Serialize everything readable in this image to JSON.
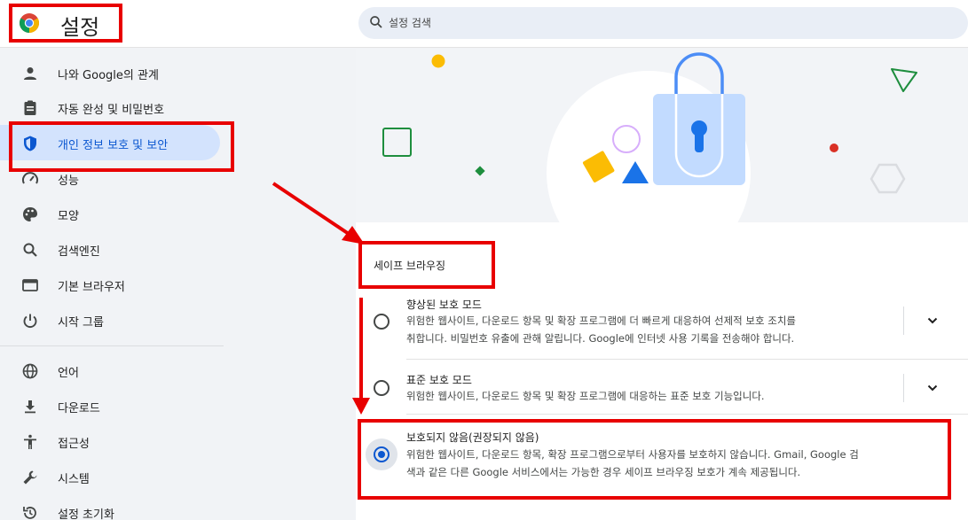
{
  "header": {
    "app_title": "설정",
    "search_placeholder": "설정 검색"
  },
  "sidebar": {
    "items": [
      {
        "label": "나와 Google의 관계",
        "icon": "person-icon"
      },
      {
        "label": "자동 완성 및 비밀번호",
        "icon": "clipboard-icon"
      },
      {
        "label": "개인 정보 보호 및 보안",
        "icon": "shield-icon",
        "active": true
      },
      {
        "label": "성능",
        "icon": "speedometer-icon"
      },
      {
        "label": "모양",
        "icon": "palette-icon"
      },
      {
        "label": "검색엔진",
        "icon": "search-icon"
      },
      {
        "label": "기본 브라우저",
        "icon": "browser-icon"
      },
      {
        "label": "시작 그룹",
        "icon": "power-icon"
      },
      {
        "label": "언어",
        "icon": "globe-icon"
      },
      {
        "label": "다운로드",
        "icon": "download-icon"
      },
      {
        "label": "접근성",
        "icon": "accessibility-icon"
      },
      {
        "label": "시스템",
        "icon": "wrench-icon"
      },
      {
        "label": "설정 초기화",
        "icon": "reset-icon"
      }
    ]
  },
  "main": {
    "section_title": "세이프 브라우징",
    "options": [
      {
        "title": "향상된 보호 모드",
        "desc_line1": "위험한 웹사이트, 다운로드 항목 및 확장 프로그램에 더 빠르게 대응하여 선제적 보호 조치를",
        "desc_line2": "취합니다. 비밀번호 유출에 관해 알립니다. Google에 인터넷 사용 기록을 전송해야 합니다.",
        "selected": false
      },
      {
        "title": "표준 보호 모드",
        "desc_line1": "위험한 웹사이트, 다운로드 항목 및 확장 프로그램에 대응하는 표준 보호 기능입니다.",
        "desc_line2": "",
        "selected": false
      },
      {
        "title": "보호되지 않음(권장되지 않음)",
        "desc_line1": "위험한 웹사이트, 다운로드 항목, 확장 프로그램으로부터 사용자를 보호하지 않습니다. Gmail, Google 검",
        "desc_line2": "색과 같은 다른 Google 서비스에서는 가능한 경우 세이프 브라우징 보호가 계속 제공됩니다.",
        "selected": true
      }
    ]
  },
  "colors": {
    "accent": "#0b57d0",
    "active_nav_bg": "#d3e3fd",
    "annotation_red": "#e80000"
  }
}
